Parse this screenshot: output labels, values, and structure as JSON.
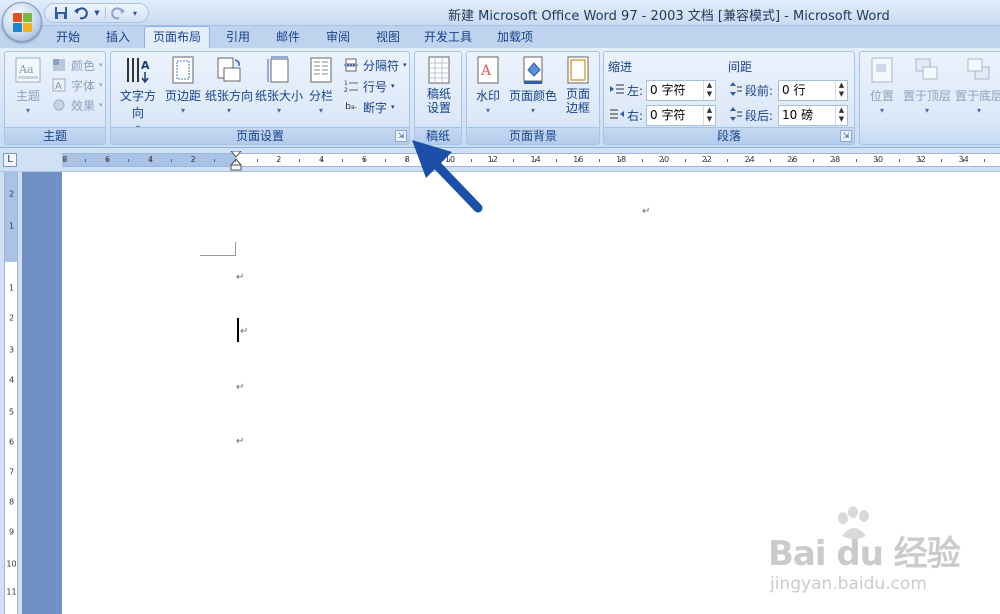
{
  "window": {
    "title": "新建 Microsoft Office Word 97 - 2003 文档 [兼容模式] - Microsoft Word"
  },
  "quick_access": {
    "save_icon": "save-icon",
    "undo_icon": "undo-icon",
    "redo_icon": "redo-icon",
    "customize_icon": "customize-icon"
  },
  "tabs": [
    {
      "label": "开始"
    },
    {
      "label": "插入"
    },
    {
      "label": "页面布局",
      "active": true
    },
    {
      "label": "引用"
    },
    {
      "label": "邮件"
    },
    {
      "label": "审阅"
    },
    {
      "label": "视图"
    },
    {
      "label": "开发工具"
    },
    {
      "label": "加载项"
    }
  ],
  "ribbon": {
    "theme": {
      "label": "主题",
      "themes_button": "主题",
      "colors": "颜色",
      "fonts": "字体",
      "effects": "效果"
    },
    "page_setup": {
      "label": "页面设置",
      "text_direction": "文字方向",
      "margins": "页边距",
      "orientation": "纸张方向",
      "size": "纸张大小",
      "columns": "分栏",
      "breaks": "分隔符",
      "line_numbers": "行号",
      "hyphenation": "断字"
    },
    "manuscript": {
      "label": "稿纸",
      "button_line1": "稿纸",
      "button_line2": "设置"
    },
    "page_background": {
      "label": "页面背景",
      "watermark": "水印",
      "page_color": "页面颜色",
      "page_borders_line1": "页面",
      "page_borders_line2": "边框"
    },
    "paragraph": {
      "label": "段落",
      "indent_heading": "缩进",
      "spacing_heading": "间距",
      "left_label": "左:",
      "left_value": "0 字符",
      "right_label": "右:",
      "right_value": "0 字符",
      "before_label": "段前:",
      "before_value": "0 行",
      "after_label": "段后:",
      "after_value": "10 磅"
    },
    "arrange": {
      "position": "位置",
      "bring_front": "置于顶层",
      "send_back": "置于底层"
    }
  },
  "ruler": {
    "horizontal_numbers": [
      "8",
      "6",
      "4",
      "2",
      "2",
      "4",
      "6",
      "8",
      "10",
      "12",
      "14",
      "16",
      "18",
      "20",
      "22",
      "24",
      "26",
      "28",
      "30",
      "32",
      "34"
    ],
    "vertical_numbers": [
      "2",
      "1",
      "1",
      "2",
      "3",
      "4",
      "5",
      "6",
      "7",
      "8",
      "9",
      "10",
      "11"
    ]
  },
  "watermark": {
    "brand": "Bai du 经验",
    "url": "jingyan.baidu.com"
  },
  "colors": {
    "annotation_arrow": "#1c4fa8",
    "ribbon_text": "#15428b"
  }
}
